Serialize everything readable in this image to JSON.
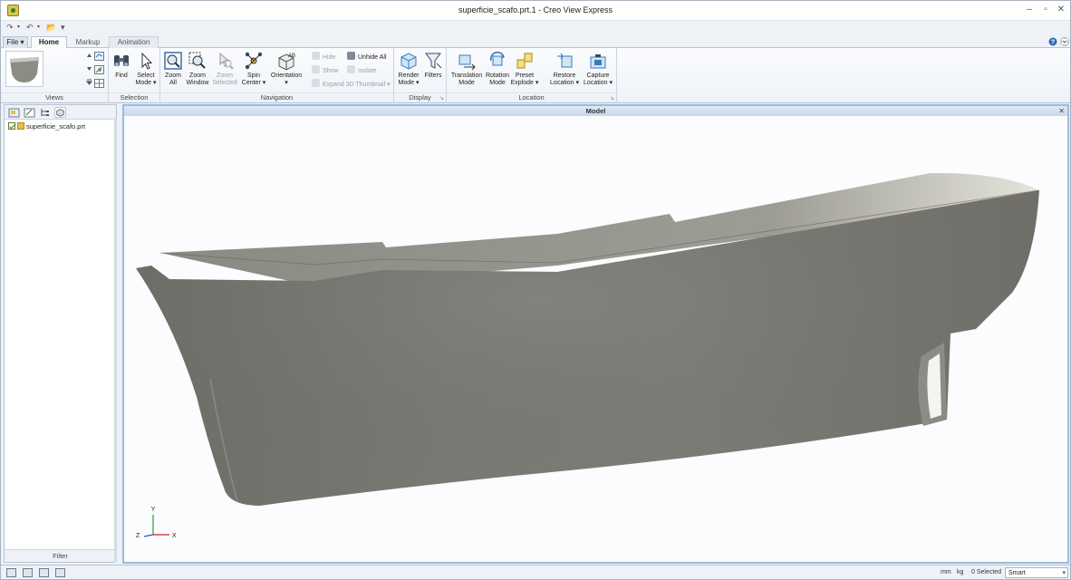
{
  "window": {
    "title": "superficie_scafo.prt.1 - Creo View Express",
    "controls": {
      "minimize": "–",
      "maximize": "▫",
      "close": "✕"
    }
  },
  "quick_access": {
    "redo": "↷",
    "undo": "↶",
    "open": "📂",
    "customize": "▾"
  },
  "tabs": {
    "file": "File ▾",
    "home": "Home",
    "markup": "Markup",
    "animation": "Animation"
  },
  "ribbon": {
    "views": {
      "label": "Views"
    },
    "selection": {
      "label": "Selection",
      "find": "Find",
      "select_mode_1": "Select",
      "select_mode_2": "Mode ▾"
    },
    "navigation": {
      "label": "Navigation",
      "zoom_all_1": "Zoom",
      "zoom_all_2": "All",
      "zoom_window_1": "Zoom",
      "zoom_window_2": "Window",
      "zoom_selected_1": "Zoom",
      "zoom_selected_2": "Selected",
      "spin_center_1": "Spin",
      "spin_center_2": "Center ▾",
      "orientation_1": "Orientation",
      "orientation_2": "▾",
      "hide": "Hide",
      "unhide_all": "Unhide All",
      "show": "Show",
      "isolate": "Isolate",
      "expand_3d_thumbnail": "Expand 3D Thumbnail ▾"
    },
    "display": {
      "label": "Display",
      "render_mode_1": "Render",
      "render_mode_2": "Mode ▾",
      "filters": "Filters"
    },
    "location": {
      "label": "Location",
      "translation_mode_1": "Translation",
      "translation_mode_2": "Mode",
      "rotation_mode_1": "Rotation",
      "rotation_mode_2": "Mode",
      "preset_explode_1": "Preset",
      "preset_explode_2": "Explode ▾",
      "restore_location_1": "Restore",
      "restore_location_2": "Location ▾",
      "capture_location_1": "Capture",
      "capture_location_2": "Location ▾"
    }
  },
  "structure_tree": {
    "item": "superficie_scafo.prt",
    "filter": "Filter"
  },
  "viewport": {
    "title": "Model",
    "close": "✕",
    "triad": {
      "x": "X",
      "y": "Y",
      "z": "Z"
    }
  },
  "status": {
    "units_length": "mm",
    "units_mass": "kg",
    "selected": "0 Selected",
    "mode": "Smart"
  },
  "colors": {
    "hull": "#76756e",
    "deck": "#b7b6ae",
    "ribbon_bg": "#eef2f7",
    "viewport_border": "#9bbbe0"
  }
}
